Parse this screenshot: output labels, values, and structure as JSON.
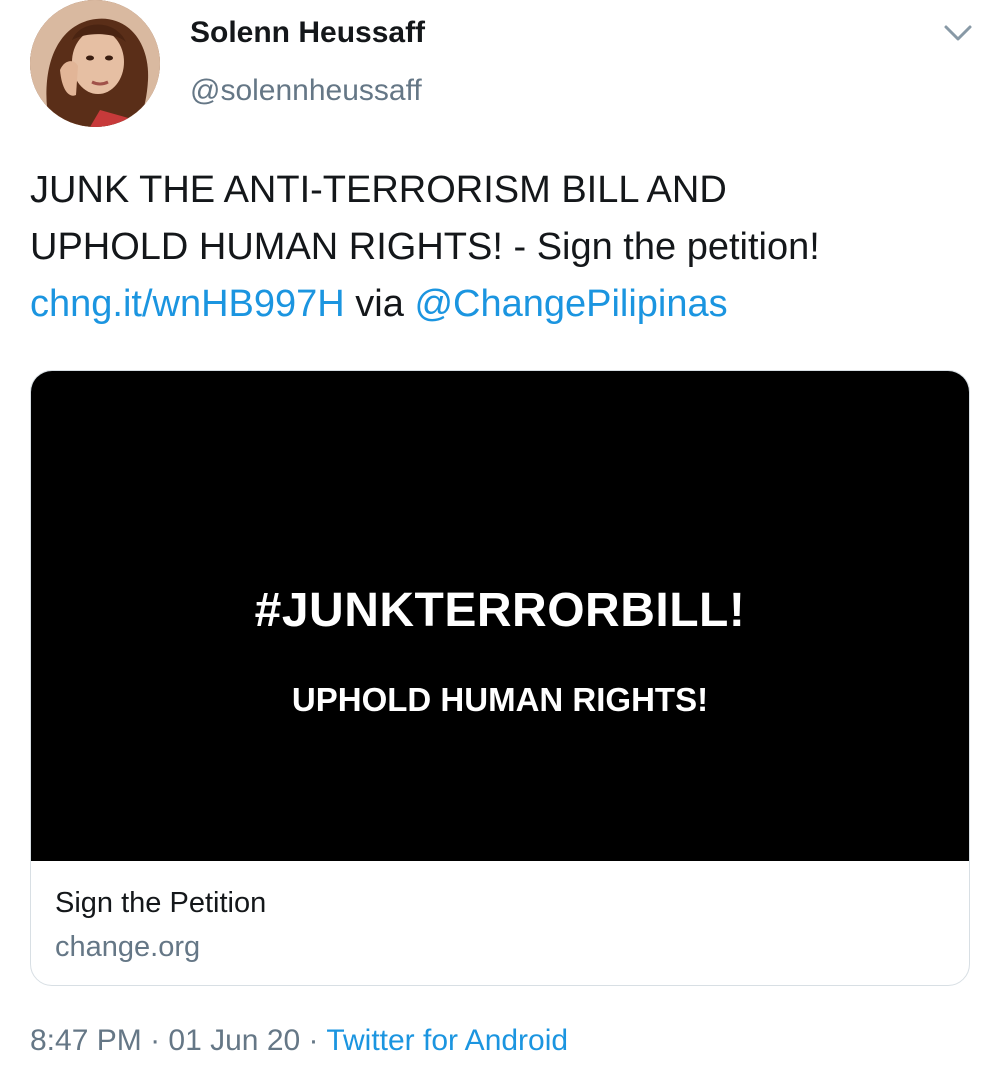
{
  "author": {
    "display_name": "Solenn Heussaff",
    "handle": "@solennheussaff"
  },
  "header": {
    "menu_icon": "chevron-down-icon"
  },
  "tweet": {
    "line1": "JUNK THE ANTI-TERRORISM BILL AND",
    "line2": "UPHOLD HUMAN RIGHTS! - Sign the petition!",
    "link_text": "chng.it/wnHB997H",
    "via_text": " via ",
    "mention": "@ChangePilipinas"
  },
  "card": {
    "image_headline": "#JUNKTERRORBILL!",
    "image_subline": "UPHOLD HUMAN RIGHTS!",
    "title": "Sign the Petition",
    "domain": "change.org"
  },
  "meta": {
    "time": "8:47 PM",
    "separator": " · ",
    "date": "01 Jun 20",
    "source": "Twitter for Android"
  },
  "colors": {
    "link": "#1b95e0",
    "secondary_text": "#657786",
    "primary_text": "#14171a",
    "card_image_bg": "#000000"
  }
}
